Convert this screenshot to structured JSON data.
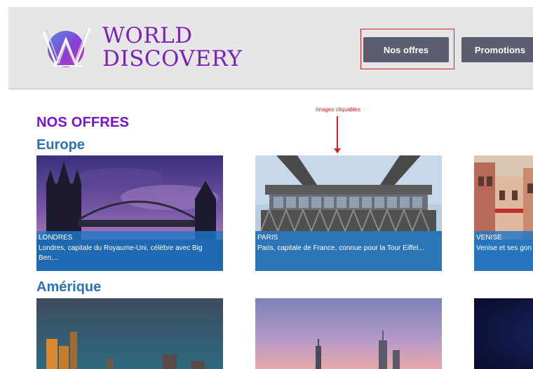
{
  "header": {
    "logo_line1": "WORLD",
    "logo_line2": "DISCOVERY",
    "nav": {
      "offres_label": "Nos offres",
      "promos_label": "Promotions"
    }
  },
  "annotation": {
    "text": "Images cliquables"
  },
  "main": {
    "title": "NOS OFFRES",
    "sections": [
      {
        "title": "Europe",
        "cards": [
          {
            "name": "LONDRES",
            "desc": "Londres, capitale du Royaume-Uni, célèbre avec Big Ben,..."
          },
          {
            "name": "PARIS",
            "desc": "Paris, capitale de France, connue pour la Tour Eiffel..."
          },
          {
            "name": "VENISE",
            "desc": "Venise et ses gon les..."
          }
        ]
      },
      {
        "title": "Amérique"
      }
    ]
  },
  "colors": {
    "header_bg": "#e6e6e6",
    "brand_purple": "#7a22b8",
    "nav_button": "#5b5e6e",
    "section_blue": "#2a72b8",
    "caption_overlay": "#1e78c8",
    "annotation_red": "#d42020"
  }
}
